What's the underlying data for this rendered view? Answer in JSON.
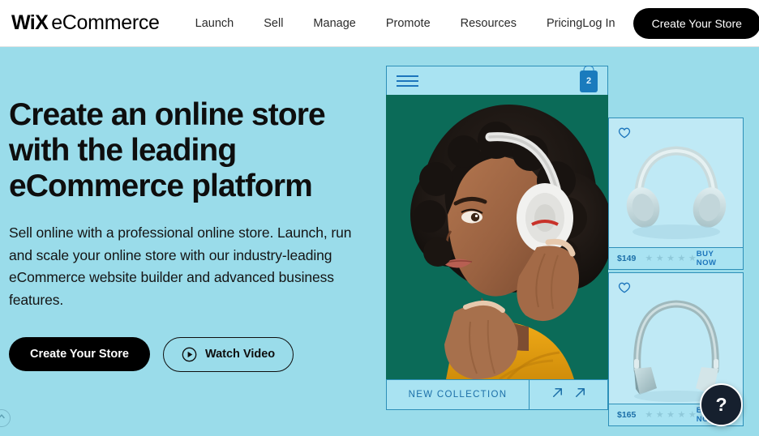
{
  "header": {
    "logo": {
      "brand": "WiX",
      "product": "eCommerce"
    },
    "nav": [
      {
        "label": "Launch"
      },
      {
        "label": "Sell"
      },
      {
        "label": "Manage"
      },
      {
        "label": "Promote"
      },
      {
        "label": "Resources"
      },
      {
        "label": "Pricing"
      }
    ],
    "login_label": "Log In",
    "cta_label": "Create Your Store"
  },
  "hero": {
    "headline": "Create an online store with the leading eCommerce platform",
    "subtext": "Sell online with a professional online store. Launch, run and scale your online store with our industry-leading eCommerce website builder and advanced business features.",
    "primary_cta": "Create Your Store",
    "secondary_cta": "Watch Video",
    "secondary_icon": "play-circle-icon"
  },
  "store_mock": {
    "menu_icon": "hamburger-menu-icon",
    "cart": {
      "icon": "shopping-bag-icon",
      "count": "2"
    },
    "collection": {
      "label": "NEW COLLECTION",
      "arrow_icon": "arrow-up-right-icon"
    },
    "products": [
      {
        "wishlist_icon": "heart-icon",
        "image_alt": "light-blue-headphones",
        "price": "$149",
        "rating": 5,
        "buy_label": "BUY NOW"
      },
      {
        "wishlist_icon": "heart-icon",
        "image_alt": "blue-gray-headphones",
        "price": "$165",
        "rating": 5,
        "buy_label": "BUY NOW"
      }
    ],
    "photo_alt": "woman-wearing-white-headphones"
  },
  "widgets": {
    "help_label": "?",
    "help_icon": "question-mark-icon",
    "scroll_icon": "chevron-up-icon"
  },
  "colors": {
    "page_bg": "#9adcea",
    "accent_blue": "#1c75bc",
    "panel_border": "#2d8fb8",
    "card_bg": "#bfe9f5",
    "dark": "#000000"
  }
}
